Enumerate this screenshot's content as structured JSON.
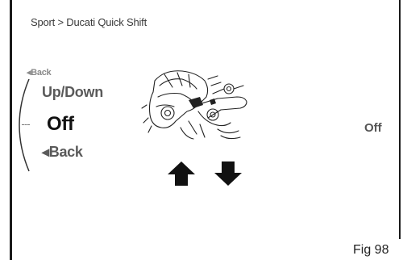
{
  "breadcrumb": "Sport > Ducati Quick Shift",
  "menu": {
    "back_small": "Back",
    "items": [
      {
        "label": "Up/Down"
      },
      {
        "label": "Off"
      },
      {
        "label": "Back"
      }
    ]
  },
  "illustration": {
    "icon": "quick-shift-pedal-illustration"
  },
  "nav": {
    "up_icon": "arrow-up-icon",
    "down_icon": "arrow-down-icon"
  },
  "current_value": "Off",
  "caption": "Fig 98",
  "colors": {
    "background": "#ffffff",
    "text_dark": "#111111",
    "text_muted": "#5a5a5a"
  }
}
